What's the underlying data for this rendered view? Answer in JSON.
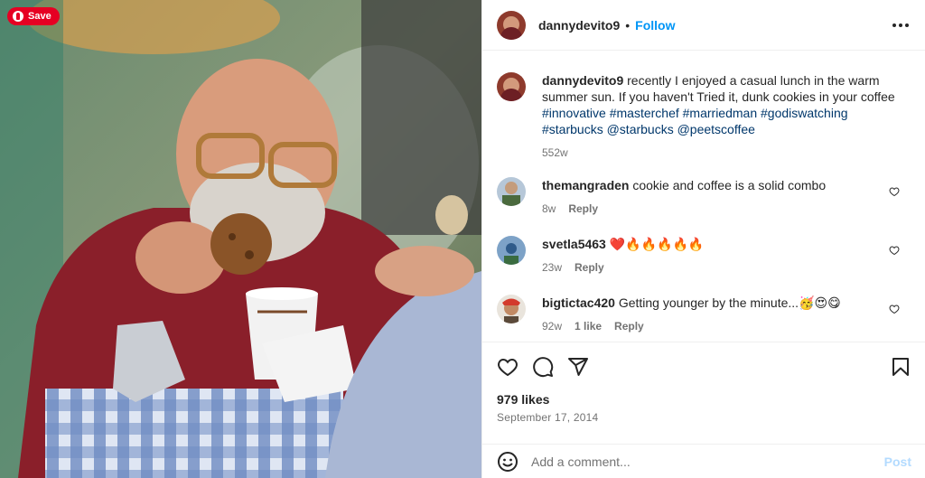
{
  "colors": {
    "accent": "#0095f6",
    "hashtag": "#00376b",
    "pinterest": "#e60023",
    "muted": "#737373",
    "heart": "#ed4956"
  },
  "photo": {
    "save_label": "Save",
    "alt": ""
  },
  "header": {
    "username": "dannydevito9",
    "separator": "•",
    "follow_label": "Follow",
    "more_icon": "more-horizontal-icon"
  },
  "caption": {
    "username": "dannydevito9",
    "text": "recently I enjoyed a casual lunch in the warm summer sun. If you haven't Tried it, dunk cookies in your coffee",
    "tags": "#innovative #masterchef #marriedman #godiswatching #starbucks @starbucks @peetscoffee",
    "age": "552w"
  },
  "comments": [
    {
      "username": "themangraden",
      "text": "cookie and coffee is a solid combo",
      "age": "8w",
      "likes": "",
      "reply_label": "Reply"
    },
    {
      "username": "svetla5463",
      "text": "❤️🔥🔥🔥🔥🔥",
      "age": "23w",
      "likes": "",
      "reply_label": "Reply"
    },
    {
      "username": "bigtictac420",
      "text": "Getting younger by the minute...🥳😍😋",
      "age": "92w",
      "likes": "1 like",
      "reply_label": "Reply"
    }
  ],
  "actions": {
    "like_icon": "heart-icon",
    "comment_icon": "comment-icon",
    "share_icon": "send-icon",
    "save_icon": "bookmark-icon"
  },
  "likes": "979 likes",
  "date": "September 17, 2014",
  "add_comment": {
    "placeholder": "Add a comment...",
    "emoji_icon": "emoji-icon",
    "post_label": "Post"
  }
}
